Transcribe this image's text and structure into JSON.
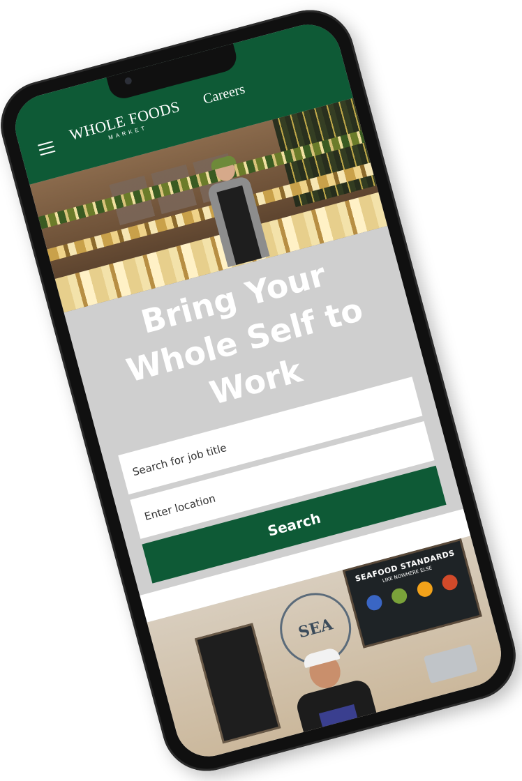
{
  "header": {
    "logo_top": "WHOLE FOODS",
    "logo_bottom": "MARKET",
    "section": "Careers",
    "menu_icon": "hamburger-menu-icon",
    "background": "#0e5a36"
  },
  "hero": {
    "headline": "Bring Your Whole Self to Work"
  },
  "search": {
    "job_placeholder": "Search for job title",
    "location_placeholder": "Enter location",
    "button_label": "Search"
  },
  "seafood_sign": {
    "title": "SEAFOOD STANDARDS",
    "subtitle": "LIKE NOWHERE ELSE",
    "circle_text": "SEA",
    "dot_colors": [
      "#3a66c4",
      "#7aa23a",
      "#f2a21a",
      "#d24a2a"
    ]
  },
  "colors": {
    "brand_green": "#0e5a36",
    "page_background": "#cfcfcf"
  }
}
